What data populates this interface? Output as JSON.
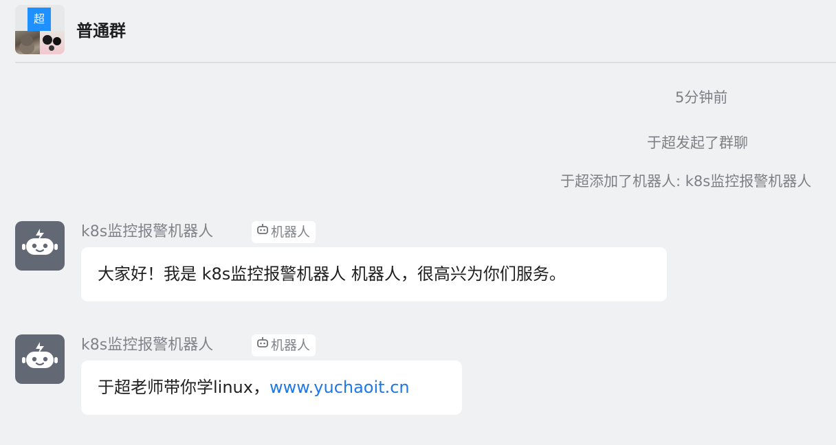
{
  "header": {
    "group_badge": "超",
    "title": "普通群"
  },
  "system": {
    "time": "5分钟前",
    "events": [
      "于超发起了群聊",
      "于超添加了机器人: k8s监控报警机器人"
    ]
  },
  "messages": [
    {
      "sender": "k8s监控报警机器人",
      "tag": "机器人",
      "text": "大家好！我是 k8s监控报警机器人 机器人，很高兴为你们服务。"
    },
    {
      "sender": "k8s监控报警机器人",
      "tag": "机器人",
      "text": "于超老师带你学linux，",
      "link": "www.yuchaoit.cn"
    }
  ],
  "colors": {
    "background": "#f0f1f3",
    "accent": "#1e90ff",
    "link": "#1e78e6",
    "bot_avatar": "#626975"
  },
  "icons": {
    "bot_avatar": "robot-icon",
    "tag": "robot-tag-icon"
  }
}
